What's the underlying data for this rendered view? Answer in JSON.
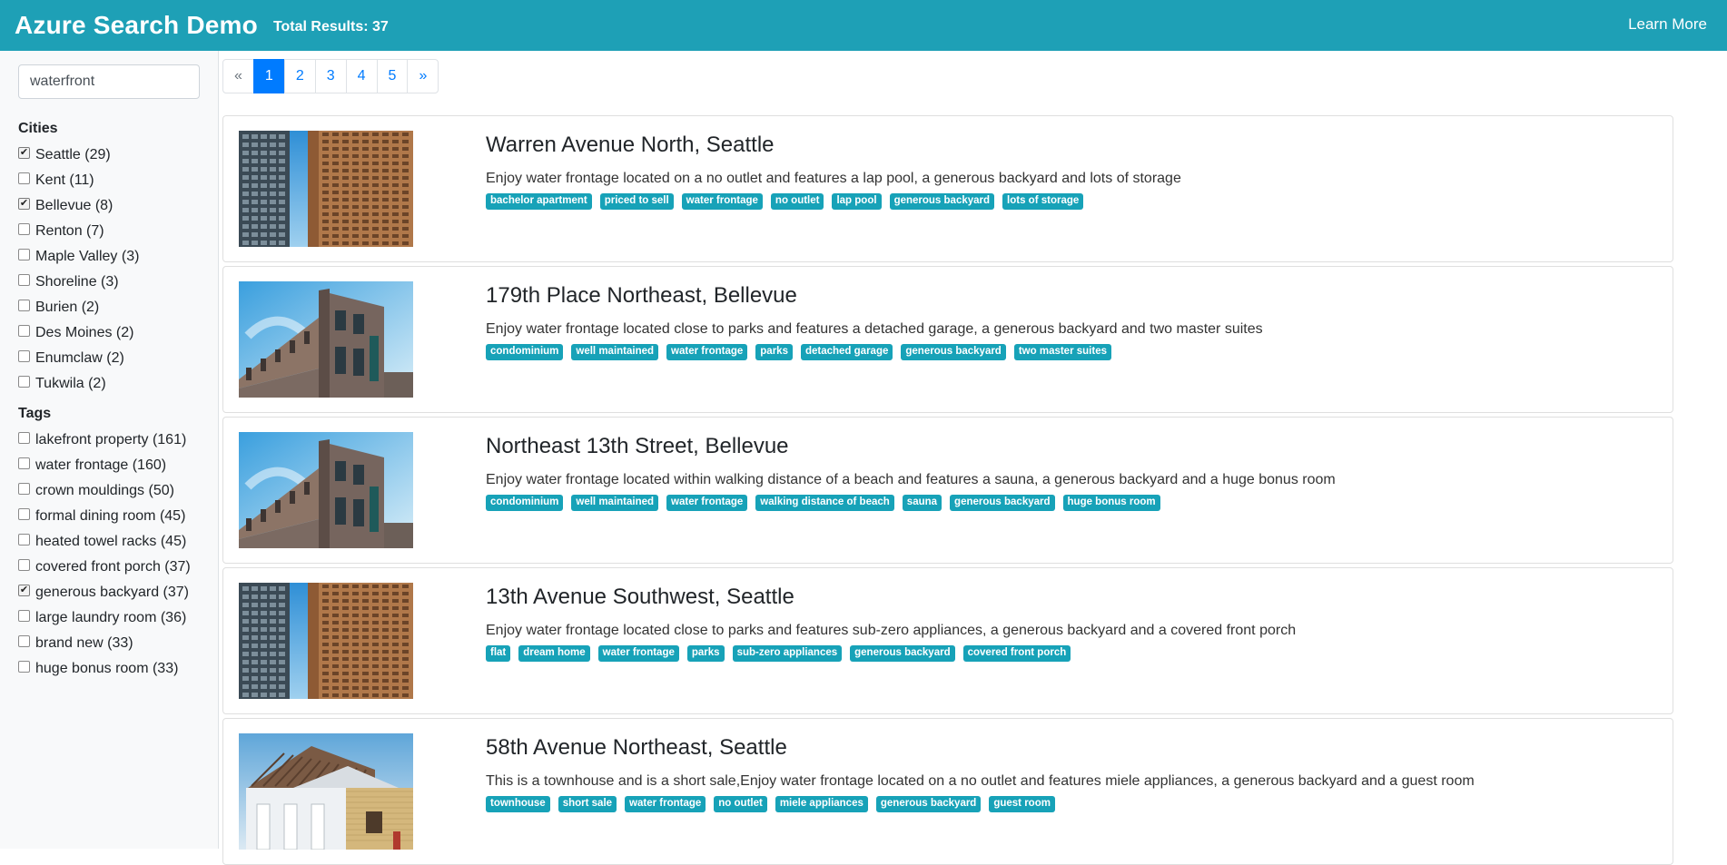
{
  "header": {
    "title": "Azure Search Demo",
    "total_results": "Total Results: 37",
    "learn_more": "Learn More"
  },
  "search": {
    "value": "waterfront"
  },
  "facets": {
    "cities_title": "Cities",
    "cities": [
      {
        "label": "Seattle (29)",
        "checked": true
      },
      {
        "label": "Kent (11)",
        "checked": false
      },
      {
        "label": "Bellevue (8)",
        "checked": true
      },
      {
        "label": "Renton (7)",
        "checked": false
      },
      {
        "label": "Maple Valley (3)",
        "checked": false
      },
      {
        "label": "Shoreline (3)",
        "checked": false
      },
      {
        "label": "Burien (2)",
        "checked": false
      },
      {
        "label": "Des Moines (2)",
        "checked": false
      },
      {
        "label": "Enumclaw (2)",
        "checked": false
      },
      {
        "label": "Tukwila (2)",
        "checked": false
      }
    ],
    "tags_title": "Tags",
    "tags": [
      {
        "label": "lakefront property (161)",
        "checked": false
      },
      {
        "label": "water frontage (160)",
        "checked": false
      },
      {
        "label": "crown mouldings (50)",
        "checked": false
      },
      {
        "label": "formal dining room (45)",
        "checked": false
      },
      {
        "label": "heated towel racks (45)",
        "checked": false
      },
      {
        "label": "covered front porch (37)",
        "checked": false
      },
      {
        "label": "generous backyard (37)",
        "checked": true
      },
      {
        "label": "large laundry room (36)",
        "checked": false
      },
      {
        "label": "brand new (33)",
        "checked": false
      },
      {
        "label": "huge bonus room (33)",
        "checked": false
      }
    ]
  },
  "pagination": [
    "«",
    "1",
    "2",
    "3",
    "4",
    "5",
    "»"
  ],
  "pagination_active": "1",
  "results": [
    {
      "title": "Warren Avenue North, Seattle",
      "image": "tower-image",
      "description": "Enjoy water frontage located on a no outlet and features a lap pool, a generous backyard and lots of storage",
      "tags": [
        "bachelor apartment",
        "priced to sell",
        "water frontage",
        "no outlet",
        "lap pool",
        "generous backyard",
        "lots of storage"
      ]
    },
    {
      "title": "179th Place Northeast, Bellevue",
      "image": "brick-building-image",
      "description": "Enjoy water frontage located close to parks and features a detached garage, a generous backyard and two master suites",
      "tags": [
        "condominium",
        "well maintained",
        "water frontage",
        "parks",
        "detached garage",
        "generous backyard",
        "two master suites"
      ]
    },
    {
      "title": "Northeast 13th Street, Bellevue",
      "image": "brick-building-image",
      "description": "Enjoy water frontage located within walking distance of a beach and features a sauna, a generous backyard and a huge bonus room",
      "tags": [
        "condominium",
        "well maintained",
        "water frontage",
        "walking distance of beach",
        "sauna",
        "generous backyard",
        "huge bonus room"
      ]
    },
    {
      "title": "13th Avenue Southwest, Seattle",
      "image": "tower-image",
      "description": "Enjoy water frontage located close to parks and features sub-zero appliances, a generous backyard and a covered front porch",
      "tags": [
        "flat",
        "dream home",
        "water frontage",
        "parks",
        "sub-zero appliances",
        "generous backyard",
        "covered front porch"
      ]
    },
    {
      "title": "58th Avenue Northeast, Seattle",
      "image": "house-image",
      "description": "This is a townhouse and is a short sale,Enjoy water frontage located on a no outlet and features miele appliances, a generous backyard and a guest room",
      "tags": [
        "townhouse",
        "short sale",
        "water frontage",
        "no outlet",
        "miele appliances",
        "generous backyard",
        "guest room"
      ]
    }
  ],
  "colors": {
    "navbar": "#1ea0b6",
    "tag": "#17a2b8",
    "page_active": "#007bff"
  }
}
